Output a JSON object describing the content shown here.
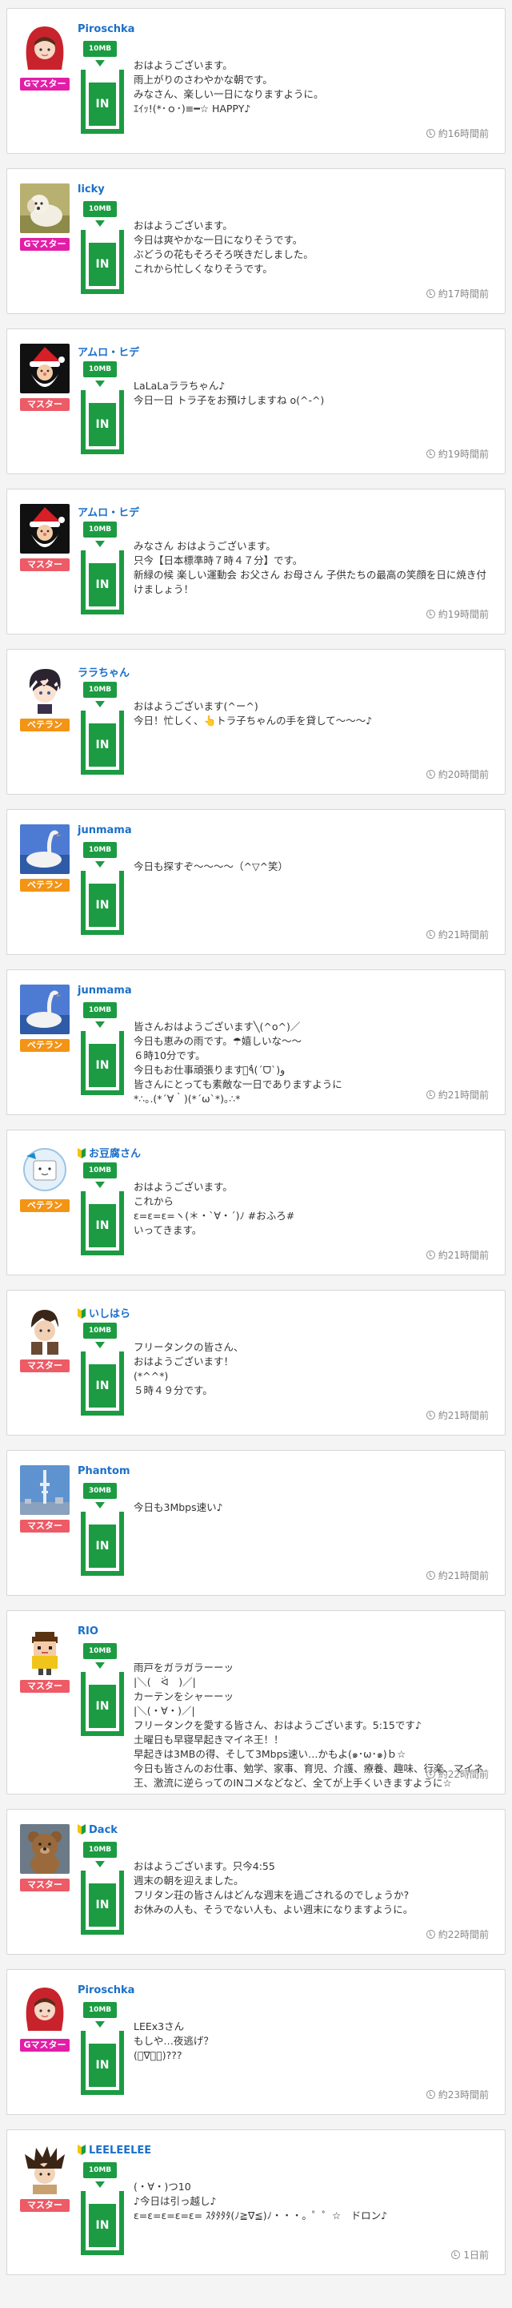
{
  "colors": {
    "link_blue": "#1a6fc9",
    "speed_green": "#1c9b42",
    "rank_gmaster": "#e21ea8",
    "rank_master": "#ec5b66",
    "rank_veteran": "#f39416"
  },
  "posts": [
    {
      "user": "Piroschka",
      "beginner": false,
      "rank": "Gマスター",
      "rank_type": "gmaster",
      "avatar": "red-hood-girl",
      "speed": "10MB",
      "in_label": "IN",
      "message": "おはようございます。\n雨上がりのさわやかな朝です。\nみなさん、楽しい一日になりますように。\nｴｲｯ!(*･ｏ･)≡━☆ HAPPY♪",
      "time": "約16時間前"
    },
    {
      "user": "licky",
      "beginner": false,
      "rank": "Gマスター",
      "rank_type": "gmaster",
      "avatar": "white-dog",
      "speed": "10MB",
      "in_label": "IN",
      "message": "おはようございます。\n今日は爽やかな一日になりそうです。\nぶどうの花もそろそろ咲きだしました。\nこれから忙しくなりそうです。",
      "time": "約17時間前"
    },
    {
      "user": "アムロ・ヒデ",
      "beginner": false,
      "rank": "マスター",
      "rank_type": "master",
      "avatar": "santa",
      "speed": "10MB",
      "in_label": "IN",
      "message": "LaLaLaララちゃん♪\n今日一日 トラ子をお預けしますね o(^-^)",
      "time": "約19時間前"
    },
    {
      "user": "アムロ・ヒデ",
      "beginner": false,
      "rank": "マスター",
      "rank_type": "master",
      "avatar": "santa",
      "speed": "10MB",
      "in_label": "IN",
      "message": "みなさん おはようございます。\n只今【日本標準時７時４７分】です。\n新緑の候 楽しい運動会 お父さん お母さん 子供たちの最高の笑顔を日に焼き付けましょう！",
      "time": "約19時間前"
    },
    {
      "user": "ララちゃん",
      "beginner": false,
      "rank": "ベテラン",
      "rank_type": "veteran",
      "avatar": "anime-boy",
      "speed": "10MB",
      "in_label": "IN",
      "message": "おはようございます(^ー^)\n今日！忙しく、👆トラ子ちゃんの手を貸して〜〜〜♪",
      "time": "約20時間前"
    },
    {
      "user": "junmama",
      "beginner": false,
      "rank": "ベテラン",
      "rank_type": "veteran",
      "avatar": "swan",
      "speed": "10MB",
      "in_label": "IN",
      "message": "今日も探すぞ〜〜〜〜（^▽^笑）",
      "time": "約21時間前"
    },
    {
      "user": "junmama",
      "beginner": false,
      "rank": "ベテラン",
      "rank_type": "veteran",
      "avatar": "swan",
      "speed": "10MB",
      "in_label": "IN",
      "message": "皆さんおはようございます╲(^o^)／\n今日も恵みの雨です。☂嬉しいな〜〜\n６時10分です。\n今日もお仕事頑張ります。ٌ٩(ˊᗜˋ)و\n皆さんにとっても素敵な一日でありますように\n*∴｡.(*´∀｀)(*´ω`*)｡∴*",
      "time": "約21時間前"
    },
    {
      "user": "お豆腐さん",
      "beginner": true,
      "rank": "ベテラン",
      "rank_type": "veteran",
      "avatar": "tofu",
      "speed": "10MB",
      "in_label": "IN",
      "message": "おはようございます。\nこれから\nε=ε=ε=ヽ(＊・`∀・´)ﾉ #おふろ#\nいってきます。",
      "time": "約21時間前"
    },
    {
      "user": "いしはら",
      "beginner": true,
      "rank": "マスター",
      "rank_type": "master",
      "avatar": "anime-man",
      "speed": "10MB",
      "in_label": "IN",
      "message": "フリータンクの皆さん、\nおはようございます！\n(*^^*)\n５時４９分です。",
      "time": "約21時間前"
    },
    {
      "user": "Phantom",
      "beginner": false,
      "rank": "マスター",
      "rank_type": "master",
      "avatar": "tower",
      "speed": "30MB",
      "in_label": "IN",
      "message": "今日も3Mbps速い♪",
      "time": "約21時間前"
    },
    {
      "user": "RIO",
      "beginner": false,
      "rank": "マスター",
      "rank_type": "master",
      "avatar": "pixel-man",
      "speed": "10MB",
      "in_label": "IN",
      "message": "雨戸をガラガラーーッ\n|＼(　ᐛ　)／|\nカーテンをシャーーッ\n|＼(・∀・)／|\nフリータンクを愛する皆さん、おはようございます。5:15です♪\n土曜日も早寝早起きマイネ王！！\n早起きは3MBの得、そして3Mbps速い…かもよ(๑･ω･๑)ｂ☆\n今日も皆さんのお仕事、勉学、家事、育児、介護、療養、趣味、行楽、マイネ王、激流に逆らってのINコメなどなど、全てが上手くいきますように☆",
      "time": "約22時間前"
    },
    {
      "user": "Dack",
      "beginner": true,
      "rank": "マスター",
      "rank_type": "master",
      "avatar": "teddy-bear",
      "speed": "10MB",
      "in_label": "IN",
      "message": "おはようございます。只今4:55\n週末の朝を迎えました。\nフリタン荘の皆さんはどんな週末を過ごされるのでしょうか?\nお休みの人も、そうでない人も、よい週末になりますように。",
      "time": "約22時間前"
    },
    {
      "user": "Piroschka",
      "beginner": false,
      "rank": "Gマスター",
      "rank_type": "gmaster",
      "avatar": "red-hood-girl",
      "speed": "10MB",
      "in_label": "IN",
      "message": "LEEx3さん\nもしや…夜逃げ？\n(ﾟ∇ﾟ；)???",
      "time": "約23時間前"
    },
    {
      "user": "LEELEELEE",
      "beginner": true,
      "rank": "マスター",
      "rank_type": "master",
      "avatar": "spiky-hair",
      "speed": "10MB",
      "in_label": "IN",
      "message": "(・∀・)つ10\n♪今日は引っ越し♪\nε=ε=ε=ε=ε= ｽﾀﾀﾀﾀ(ﾉ≧∇≦)ﾉ・・・。゜゜☆　ドロン♪",
      "time": "1日前"
    }
  ]
}
